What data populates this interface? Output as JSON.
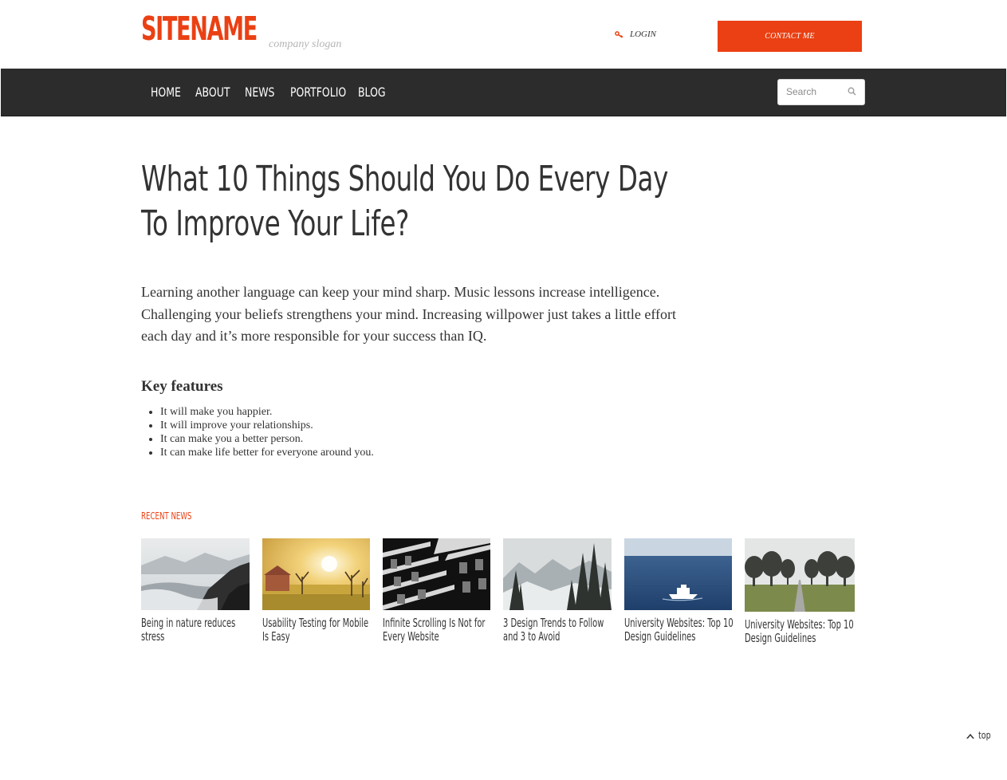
{
  "header": {
    "logo": "SITENAME",
    "slogan": "company slogan",
    "login_label": "LOGIN",
    "contact_label": "CONTACT ME"
  },
  "nav": {
    "items": [
      {
        "label": "HOME"
      },
      {
        "label": "ABOUT"
      },
      {
        "label": "NEWS"
      },
      {
        "label": "PORTFOLIO"
      },
      {
        "label": "BLOG"
      }
    ],
    "search_placeholder": "Search"
  },
  "article": {
    "title_line1": "What 10 Things Should You Do Every Day",
    "title_line2": "To Improve Your Life?",
    "intro": "Learning another language can keep your mind sharp. Music lessons increase intelligence. Challenging your beliefs strengthens your mind. Increasing willpower just takes a little effort each day and it’s more responsible for your success than IQ.",
    "key_features_heading": "Key features",
    "key_features": [
      "It will make you happier.",
      "It will improve your relationships.",
      "It can make you a better person.",
      "It can make life better for everyone around you."
    ]
  },
  "recent_news": {
    "heading": "RECENT NEWS",
    "items": [
      {
        "caption": "Being in nature reduces stress",
        "image": "coastal-rocks-photo"
      },
      {
        "caption": "Usability Testing for Mobile Is Easy",
        "image": "sunrise-field-photo"
      },
      {
        "caption": "Infinite Scrolling Is Not for Every Website",
        "image": "building-facade-photo"
      },
      {
        "caption": "3 Design Trends to Follow and 3 to Avoid",
        "image": "snowy-forest-photo"
      },
      {
        "caption": "University Websites: Top 10 Design Guidelines",
        "image": "boat-at-sea-photo"
      },
      {
        "caption": "University Websites: Top 10 Design Guidelines",
        "image": "tree-lined-path-photo"
      }
    ]
  },
  "footer": {
    "back_to_top": "top"
  },
  "colors": {
    "accent": "#ea4013",
    "navbar": "#2c2c2c",
    "text": "#333333"
  }
}
